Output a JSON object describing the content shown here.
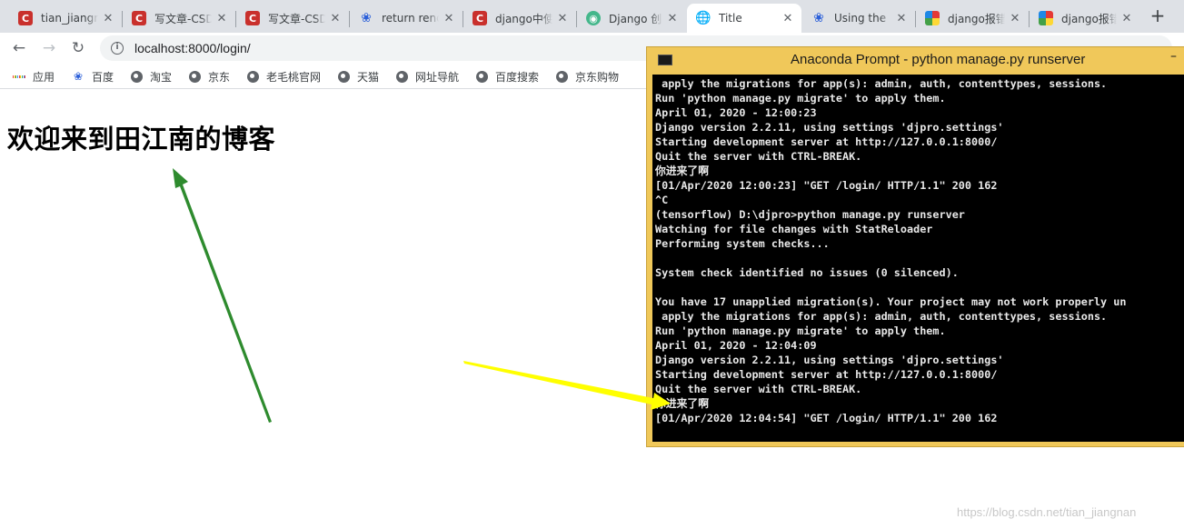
{
  "browser": {
    "tabs": [
      {
        "title": "tian_jiangnan",
        "favicon": "csdn-icon",
        "active": false
      },
      {
        "title": "写文章-CSDN博客",
        "favicon": "csdn-icon",
        "active": false
      },
      {
        "title": "写文章-CSDN博客",
        "favicon": "csdn-icon",
        "active": false
      },
      {
        "title": "return render",
        "favicon": "baidu-icon",
        "active": false
      },
      {
        "title": "django中使用",
        "favicon": "csdn-icon",
        "active": false
      },
      {
        "title": "Django 创建",
        "favicon": "django-icon",
        "active": false
      },
      {
        "title": "Title",
        "favicon": "globe-icon",
        "active": true
      },
      {
        "title": "Using the",
        "favicon": "baidu-icon",
        "active": false
      },
      {
        "title": "django报错",
        "favicon": "multicolor-icon",
        "active": false
      },
      {
        "title": "django报错",
        "favicon": "multicolor-icon",
        "active": false
      }
    ],
    "new_tab_label": "+",
    "close_glyph": "✕",
    "address": "localhost:8000/login/"
  },
  "bookmarks": [
    {
      "label": "应用",
      "icon": "apps-grid-icon"
    },
    {
      "label": "百度",
      "icon": "baidu-icon"
    },
    {
      "label": "淘宝",
      "icon": "globe-icon"
    },
    {
      "label": "京东",
      "icon": "globe-icon"
    },
    {
      "label": "老毛桃官网",
      "icon": "globe-icon"
    },
    {
      "label": "天猫",
      "icon": "globe-icon"
    },
    {
      "label": "网址导航",
      "icon": "globe-icon"
    },
    {
      "label": "百度搜索",
      "icon": "globe-icon"
    },
    {
      "label": "京东购物",
      "icon": "globe-icon"
    }
  ],
  "page": {
    "heading": "欢迎来到田江南的博客"
  },
  "console": {
    "title": "Anaconda Prompt - python  manage.py runserver",
    "minimize_glyph": "–",
    "lines": [
      " apply the migrations for app(s): admin, auth, contenttypes, sessions.",
      "Run 'python manage.py migrate' to apply them.",
      "April 01, 2020 - 12:00:23",
      "Django version 2.2.11, using settings 'djpro.settings'",
      "Starting development server at http://127.0.0.1:8000/",
      "Quit the server with CTRL-BREAK.",
      "你进来了啊",
      "[01/Apr/2020 12:00:23] \"GET /login/ HTTP/1.1\" 200 162",
      "^C",
      "(tensorflow) D:\\djpro>python manage.py runserver",
      "Watching for file changes with StatReloader",
      "Performing system checks...",
      "",
      "System check identified no issues (0 silenced).",
      "",
      "You have 17 unapplied migration(s). Your project may not work properly un",
      " apply the migrations for app(s): admin, auth, contenttypes, sessions.",
      "Run 'python manage.py migrate' to apply them.",
      "April 01, 2020 - 12:04:09",
      "Django version 2.2.11, using settings 'djpro.settings'",
      "Starting development server at http://127.0.0.1:8000/",
      "Quit the server with CTRL-BREAK.",
      "你进来了啊",
      "[01/Apr/2020 12:04:54] \"GET /login/ HTTP/1.1\" 200 162"
    ]
  },
  "annotations": {
    "arrow1_color": "#2e8b2e",
    "arrow2_color": "#ffff00"
  },
  "watermark": "https://blog.csdn.net/tian_jiangnan"
}
